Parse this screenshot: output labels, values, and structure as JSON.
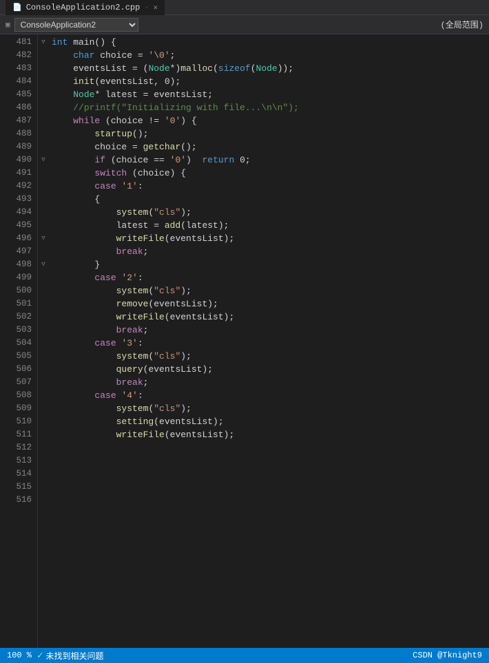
{
  "titleBar": {
    "filename": "ConsoleApplication2.cpp",
    "modified": false,
    "closeLabel": "✕"
  },
  "toolbar": {
    "projectName": "ConsoleApplication2",
    "scopeLabel": "(全局范围)"
  },
  "statusBar": {
    "zoom": "100 %",
    "warningIcon": "⚠",
    "warningText": "未找到相关问题",
    "rightText": "CSDN @Tknight9"
  },
  "lines": [
    {
      "num": "481",
      "collapse": "▽",
      "code": "<kw-blue>int</kw-blue> main() {"
    },
    {
      "num": "482",
      "collapse": "",
      "code": "    <kw-blue>char</kw-blue> choice = <char-lit>'\\0'</char-lit>;"
    },
    {
      "num": "483",
      "collapse": "",
      "code": "    eventsList = (<kw-type>Node</kw-type>*)<str-yellow>malloc</str-yellow>(<kw-blue>sizeof</kw-blue>(<kw-type>Node</kw-type>));"
    },
    {
      "num": "484",
      "collapse": "",
      "code": "    <str-yellow>init</str-yellow>(eventsList, 0);"
    },
    {
      "num": "485",
      "collapse": "",
      "code": ""
    },
    {
      "num": "486",
      "collapse": "",
      "code": "    <kw-type>Node</kw-type>* latest = eventsList;"
    },
    {
      "num": "487",
      "collapse": "",
      "code": ""
    },
    {
      "num": "488",
      "collapse": "",
      "code": "    <comment>//printf(\"Initializing with file...\\n\\n\");</comment>"
    },
    {
      "num": "489",
      "collapse": "",
      "code": ""
    },
    {
      "num": "490",
      "collapse": "▽",
      "code": "    <kw-purple>while</kw-purple> (choice != <char-lit>'0'</char-lit>) {"
    },
    {
      "num": "491",
      "collapse": "",
      "code": "        <str-yellow>startup</str-yellow>();"
    },
    {
      "num": "492",
      "collapse": "",
      "code": "        choice = <str-yellow>getchar</str-yellow>();"
    },
    {
      "num": "493",
      "collapse": "",
      "code": ""
    },
    {
      "num": "494",
      "collapse": "",
      "code": "        <kw-purple>if</kw-purple> (choice == <char-lit>'0'</char-lit>)  <kw-blue>return</kw-blue> 0;"
    },
    {
      "num": "495",
      "collapse": "",
      "code": ""
    },
    {
      "num": "496",
      "collapse": "▽",
      "code": "        <kw-purple>switch</kw-purple> (choice) {"
    },
    {
      "num": "497",
      "collapse": "",
      "code": "        <kw-purple>case</kw-purple> <char-lit>'1'</char-lit>:"
    },
    {
      "num": "498",
      "collapse": "▽",
      "code": "        {"
    },
    {
      "num": "499",
      "collapse": "",
      "code": "            <str-yellow>system</str-yellow>(<str-orange>\"cls\"</str-orange>);"
    },
    {
      "num": "500",
      "collapse": "",
      "code": "            latest = <str-yellow>add</str-yellow>(latest);"
    },
    {
      "num": "501",
      "collapse": "",
      "code": "            <str-yellow>writeFile</str-yellow>(eventsList);"
    },
    {
      "num": "502",
      "collapse": "",
      "code": "            <kw-purple>break</kw-purple>;"
    },
    {
      "num": "503",
      "collapse": "",
      "code": "        }"
    },
    {
      "num": "504",
      "collapse": "",
      "code": "        <kw-purple>case</kw-purple> <char-lit>'2'</char-lit>:"
    },
    {
      "num": "505",
      "collapse": "",
      "code": "            <str-yellow>system</str-yellow>(<str-orange>\"cls\"</str-orange>);"
    },
    {
      "num": "506",
      "collapse": "",
      "code": "            <str-yellow>remove</str-yellow>(eventsList);"
    },
    {
      "num": "507",
      "collapse": "",
      "code": "            <str-yellow>writeFile</str-yellow>(eventsList);"
    },
    {
      "num": "508",
      "collapse": "",
      "code": "            <kw-purple>break</kw-purple>;"
    },
    {
      "num": "509",
      "collapse": "",
      "code": "        <kw-purple>case</kw-purple> <char-lit>'3'</char-lit>:"
    },
    {
      "num": "510",
      "collapse": "",
      "code": "            <str-yellow>system</str-yellow>(<str-orange>\"cls\"</str-orange>);"
    },
    {
      "num": "511",
      "collapse": "",
      "code": "            <str-yellow>query</str-yellow>(eventsList);"
    },
    {
      "num": "512",
      "collapse": "",
      "code": "            <kw-purple>break</kw-purple>;"
    },
    {
      "num": "513",
      "collapse": "",
      "code": "        <kw-purple>case</kw-purple> <char-lit>'4'</char-lit>:"
    },
    {
      "num": "514",
      "collapse": "",
      "code": "            <str-yellow>system</str-yellow>(<str-orange>\"cls\"</str-orange>);"
    },
    {
      "num": "515",
      "collapse": "",
      "code": "            <str-yellow>setting</str-yellow>(eventsList);"
    },
    {
      "num": "516",
      "collapse": "",
      "code": "            <str-yellow>writeFile</str-yellow>(eventsList);"
    }
  ]
}
